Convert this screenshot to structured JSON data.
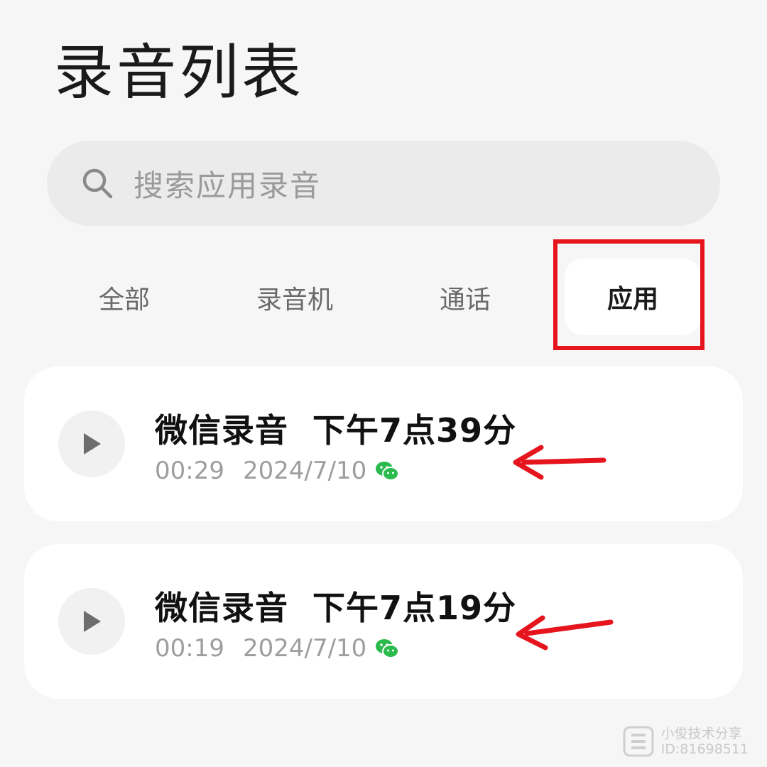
{
  "header": {
    "title": "录音列表"
  },
  "search": {
    "placeholder": "搜索应用录音",
    "icon": "search-icon"
  },
  "tabs": [
    {
      "label": "全部",
      "active": false
    },
    {
      "label": "录音机",
      "active": false
    },
    {
      "label": "通话",
      "active": false
    },
    {
      "label": "应用",
      "active": true
    }
  ],
  "recordings": [
    {
      "title": "微信录音  下午7点39分",
      "duration": "00:29",
      "date": "2024/7/10",
      "source_icon": "wechat-icon"
    },
    {
      "title": "微信录音  下午7点19分",
      "duration": "00:19",
      "date": "2024/7/10",
      "source_icon": "wechat-icon"
    }
  ],
  "annotations": {
    "highlight_color": "#e5141d",
    "arrow_color": "#e5141d"
  },
  "watermark": {
    "line1": "小俊技术分享",
    "line2": "ID:81698511"
  },
  "colors": {
    "background": "#f6f6f6",
    "card": "#ffffff",
    "search_bg": "#ebebeb",
    "wechat_green": "#2bba4e"
  }
}
